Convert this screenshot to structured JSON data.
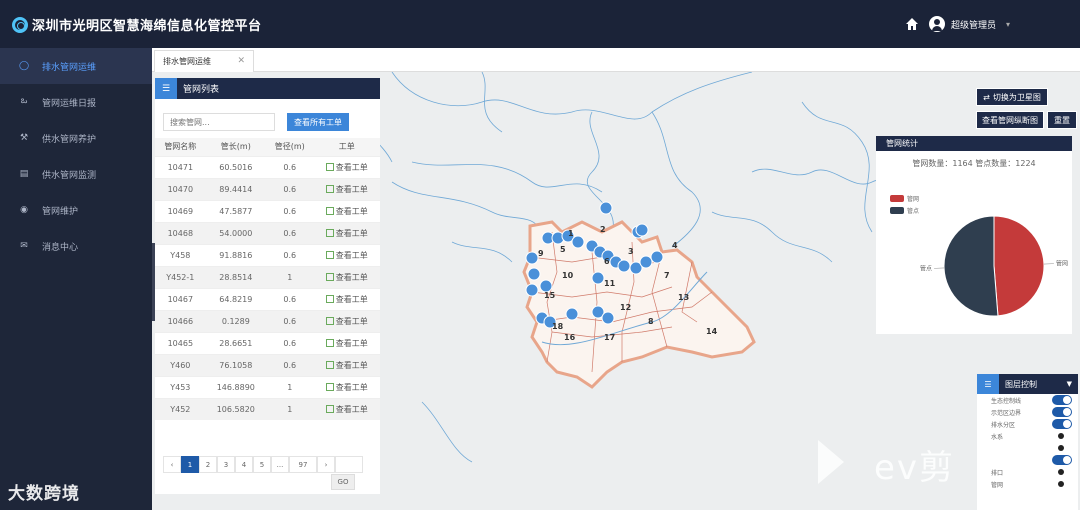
{
  "app": {
    "title": "深圳市光明区智慧海绵信息化管控平台",
    "user": "超级管理员"
  },
  "sidebar": {
    "items": [
      {
        "label": "排水管网运维",
        "icon": "user-icon",
        "active": true
      },
      {
        "label": "管网运维日报",
        "icon": "report-icon"
      },
      {
        "label": "供水管网养护",
        "icon": "tool-icon"
      },
      {
        "label": "供水管网监测",
        "icon": "monitor-icon"
      },
      {
        "label": "管网维护",
        "icon": "eye-icon"
      },
      {
        "label": "消息中心",
        "icon": "mail-icon"
      }
    ],
    "footer": "大数跨境"
  },
  "tabs": [
    {
      "label": "排水管网运维"
    }
  ],
  "pipe_list": {
    "title": "管网列表",
    "search_placeholder": "搜索管网...",
    "view_all_label": "查看所有工单",
    "columns": [
      "管网名称",
      "管长(m)",
      "管径(m)",
      "工单"
    ],
    "link_label": "查看工单",
    "rows": [
      [
        "10471",
        "60.5016",
        "0.6"
      ],
      [
        "10470",
        "89.4414",
        "0.6"
      ],
      [
        "10469",
        "47.5877",
        "0.6"
      ],
      [
        "10468",
        "54.0000",
        "0.6"
      ],
      [
        "Y458",
        "91.8816",
        "0.6"
      ],
      [
        "Y452-1",
        "28.8514",
        "1"
      ],
      [
        "10467",
        "64.8219",
        "0.6"
      ],
      [
        "10466",
        "0.1289",
        "0.6"
      ],
      [
        "10465",
        "28.6651",
        "0.6"
      ],
      [
        "Y460",
        "76.1058",
        "0.6"
      ],
      [
        "Y453",
        "146.8890",
        "1"
      ],
      [
        "Y452",
        "106.5820",
        "1"
      ]
    ],
    "pager": {
      "prev": "‹",
      "pages": [
        "1",
        "2",
        "3",
        "4",
        "5"
      ],
      "ellipsis": "...",
      "last": "97",
      "next": "›",
      "go": "GO"
    }
  },
  "map_buttons": {
    "satellite": "切换为卫星图",
    "profile": "查看管网纵断图",
    "reset": "重置"
  },
  "stats": {
    "title": "管网统计",
    "summary": "管网数量：1164 管点数量：1224",
    "legend": [
      {
        "name": "管网",
        "color": "#c43a3a"
      },
      {
        "name": "管点",
        "color": "#2f3e4f"
      }
    ],
    "chart_data": {
      "type": "pie",
      "categories": [
        "管网",
        "管点"
      ],
      "values": [
        1164,
        1224
      ],
      "colors": [
        "#c43a3a",
        "#2f3e4f"
      ]
    }
  },
  "layers": {
    "title": "图层控制",
    "items": [
      {
        "label": "生态控制线",
        "on": true
      },
      {
        "label": "示范区边界",
        "on": true
      },
      {
        "label": "排水分区",
        "on": true
      },
      {
        "label": "水系",
        "on": false
      },
      {
        "label": "",
        "on": false
      },
      {
        "label": "",
        "on": true
      },
      {
        "label": "排口",
        "on": false
      },
      {
        "label": "管网",
        "on": false
      }
    ]
  },
  "map_labels": [
    "1",
    "2",
    "3",
    "4",
    "5",
    "6",
    "7",
    "8",
    "9",
    "10",
    "11",
    "12",
    "13",
    "14",
    "15",
    "16",
    "17",
    "18"
  ],
  "watermark": "ev剪"
}
